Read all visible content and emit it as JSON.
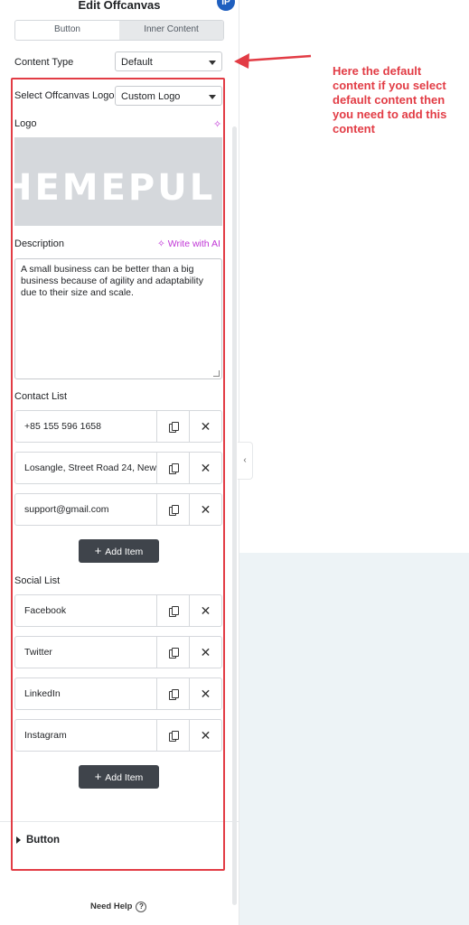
{
  "header": {
    "title": "Edit Offcanvas",
    "avatar_initials": "IP"
  },
  "tabs": [
    {
      "label": "Button"
    },
    {
      "label": "Inner Content"
    }
  ],
  "content_type": {
    "label": "Content Type",
    "value": "Default"
  },
  "logo_select": {
    "label": "Select Offcanvas Logo",
    "value": "Custom Logo"
  },
  "logo": {
    "label": "Logo",
    "image_text": "HEMEPUL"
  },
  "description": {
    "label": "Description",
    "ai_label": "Write with AI",
    "value": "A small business can be better than a big business because of agility and adaptability due to their size and scale."
  },
  "contact_list": {
    "label": "Contact List",
    "items": [
      {
        "text": "+85 155 596 1658"
      },
      {
        "text": "Losangle, Street Road 24, New"
      },
      {
        "text": "support@gmail.com"
      }
    ],
    "add_label": "Add Item"
  },
  "social_list": {
    "label": "Social List",
    "items": [
      {
        "text": "Facebook"
      },
      {
        "text": "Twitter"
      },
      {
        "text": "LinkedIn"
      },
      {
        "text": "Instagram"
      }
    ],
    "add_label": "Add Item"
  },
  "button_section": {
    "label": "Button"
  },
  "footer": {
    "need_help": "Need Help",
    "help_glyph": "?"
  },
  "collapse_glyph": "‹",
  "annotation": {
    "text": "Here the default content if you select default content then you need to add this content"
  },
  "colors": {
    "annotation_red": "#e23c45",
    "accent_purple": "#c036d6",
    "dark_button": "#3f444b"
  }
}
